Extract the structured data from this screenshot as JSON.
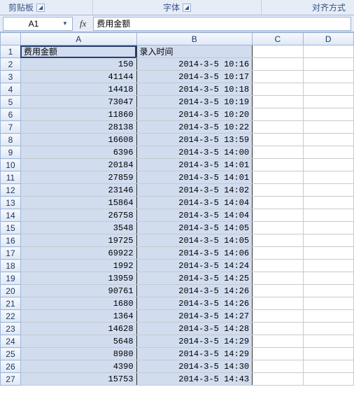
{
  "ribbon": {
    "clipboard": "剪贴板",
    "font": "字体",
    "align": "对齐方式"
  },
  "nameBox": "A1",
  "formula": "费用金额",
  "colHeaders": [
    "A",
    "B",
    "C",
    "D"
  ],
  "tableHeaders": {
    "A": "费用金额",
    "B": "录入时间"
  },
  "rows": [
    {
      "n": 1,
      "A": "费用金额",
      "B": "录入时间",
      "isHdr": true
    },
    {
      "n": 2,
      "A": "150",
      "B": "2014-3-5 10:16"
    },
    {
      "n": 3,
      "A": "41144",
      "B": "2014-3-5 10:17"
    },
    {
      "n": 4,
      "A": "14418",
      "B": "2014-3-5 10:18"
    },
    {
      "n": 5,
      "A": "73047",
      "B": "2014-3-5 10:19"
    },
    {
      "n": 6,
      "A": "11860",
      "B": "2014-3-5 10:20"
    },
    {
      "n": 7,
      "A": "28138",
      "B": "2014-3-5 10:22"
    },
    {
      "n": 8,
      "A": "16608",
      "B": "2014-3-5 13:59"
    },
    {
      "n": 9,
      "A": "6396",
      "B": "2014-3-5 14:00"
    },
    {
      "n": 10,
      "A": "20184",
      "B": "2014-3-5 14:01"
    },
    {
      "n": 11,
      "A": "27859",
      "B": "2014-3-5 14:01"
    },
    {
      "n": 12,
      "A": "23146",
      "B": "2014-3-5 14:02"
    },
    {
      "n": 13,
      "A": "15864",
      "B": "2014-3-5 14:04"
    },
    {
      "n": 14,
      "A": "26758",
      "B": "2014-3-5 14:04"
    },
    {
      "n": 15,
      "A": "3548",
      "B": "2014-3-5 14:05"
    },
    {
      "n": 16,
      "A": "19725",
      "B": "2014-3-5 14:05"
    },
    {
      "n": 17,
      "A": "69922",
      "B": "2014-3-5 14:06"
    },
    {
      "n": 18,
      "A": "1992",
      "B": "2014-3-5 14:24"
    },
    {
      "n": 19,
      "A": "13959",
      "B": "2014-3-5 14:25"
    },
    {
      "n": 20,
      "A": "90761",
      "B": "2014-3-5 14:26"
    },
    {
      "n": 21,
      "A": "1680",
      "B": "2014-3-5 14:26"
    },
    {
      "n": 22,
      "A": "1364",
      "B": "2014-3-5 14:27"
    },
    {
      "n": 23,
      "A": "14628",
      "B": "2014-3-5 14:28"
    },
    {
      "n": 24,
      "A": "5648",
      "B": "2014-3-5 14:29"
    },
    {
      "n": 25,
      "A": "8980",
      "B": "2014-3-5 14:29"
    },
    {
      "n": 26,
      "A": "4390",
      "B": "2014-3-5 14:30"
    },
    {
      "n": 27,
      "A": "15753",
      "B": "2014-3-5 14:43"
    }
  ]
}
